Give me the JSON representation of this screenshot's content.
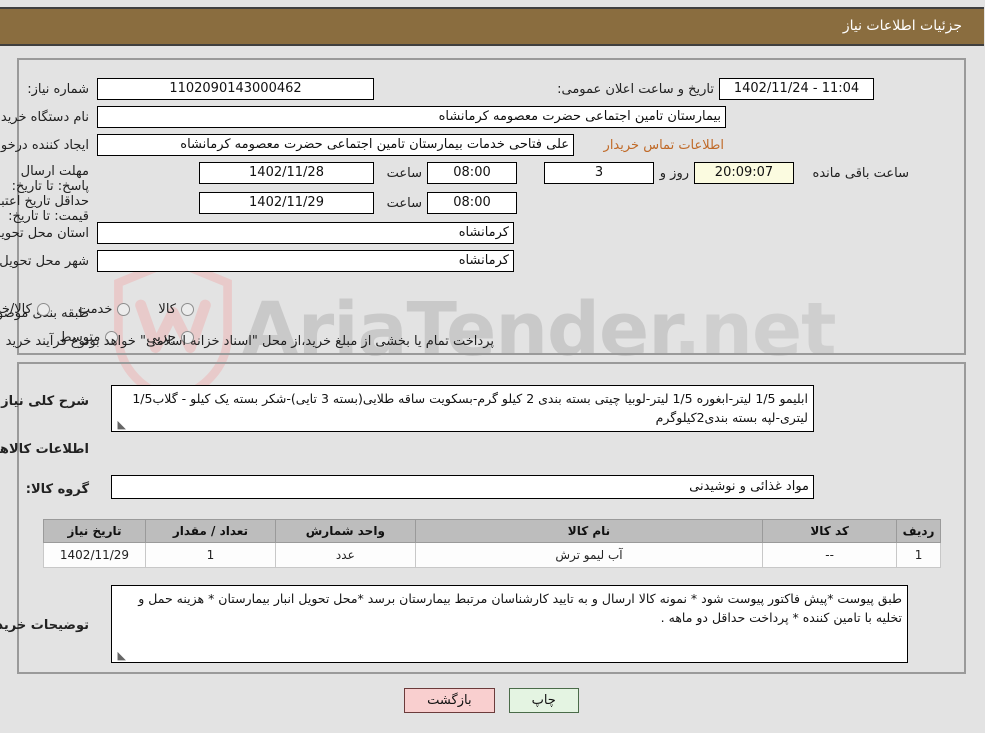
{
  "header": {
    "title": "جزئیات اطلاعات نیاز"
  },
  "watermark": {
    "text": "AriaTender",
    "suffix": ".net"
  },
  "form": {
    "need_number_label": "شماره نیاز:",
    "need_number_value": "1102090143000462",
    "announce_datetime_label": "تاریخ و ساعت اعلان عمومی:",
    "announce_datetime_value": "11:04 - 1402/11/24",
    "buyer_org_label": "نام دستگاه خریدار:",
    "buyer_org_value": "بیمارستان تامین اجتماعی حضرت معصومه کرمانشاه",
    "requester_label": "ایجاد کننده درخواست:",
    "requester_value": "علی  فتاحی خدمات بیمارستان تامین اجتماعی حضرت معصومه کرمانشاه",
    "contact_link": "اطلاعات تماس خریدار",
    "reply_deadline_label": "مهلت ارسال پاسخ: تا تاریخ:",
    "reply_deadline_date": "1402/11/28",
    "reply_deadline_time_label": "ساعت",
    "reply_deadline_time": "08:00",
    "remaining_days": "3",
    "remaining_days_label": "روز و",
    "remaining_clock": "20:09:07",
    "remaining_suffix": "ساعت باقی مانده",
    "price_validity_label": "حداقل تاریخ اعتبار قیمت: تا تاریخ:",
    "price_validity_date": "1402/11/29",
    "price_validity_time_label": "ساعت",
    "price_validity_time": "08:00",
    "province_label": "استان محل تحویل:",
    "province_value": "کرمانشاه",
    "city_label": "شهر محل تحویل:",
    "city_value": "کرمانشاه",
    "category_label": "طبقه بندی موضوعی:",
    "category_options": [
      "کالا",
      "خدمت",
      "کالا/خدمت"
    ],
    "process_label": "نوع فرآیند خرید :",
    "process_options": [
      "جزیی",
      "متوسط"
    ],
    "payment_note": "پرداخت تمام یا بخشی از مبلغ خرید،از محل \"اسناد خزانه اسلامی\" خواهد بود."
  },
  "summary": {
    "label": "شرح کلی نیاز:",
    "value": "ابلیمو 1/5 لیتر-ابغوره 1/5 لیتر-لوبیا چیتی بسته بندی 2 کیلو گرم-بسکویت ساقه طلایی(بسته 3 تایی)-شکر بسته یک کیلو  - گلاب1/5 لیتری-لپه بسته بندی2کیلوگرم"
  },
  "goods_section": {
    "title": "اطلاعات کالاهای مورد نیاز",
    "group_label": "گروه کالا:",
    "group_value": "مواد غذائی و نوشیدنی"
  },
  "table": {
    "columns": [
      "ردیف",
      "کد کالا",
      "نام کالا",
      "واحد شمارش",
      "تعداد / مقدار",
      "تاریخ نیاز"
    ],
    "rows": [
      [
        "1",
        "--",
        "آب لیمو ترش",
        "عدد",
        "1",
        "1402/11/29"
      ]
    ]
  },
  "buyer_notes": {
    "label": "توضیحات خریدار:",
    "value": "طبق پیوست *پیش فاکتور پیوست شود * نمونه کالا ارسال و به تایید کارشناسان مرتبط بیمارستان برسد *محل تحویل انبار بیمارستان * هزینه حمل و تخلیه با تامین کننده * پرداخت حداقل دو ماهه ."
  },
  "buttons": {
    "back": "بازگشت",
    "print": "چاپ"
  },
  "colors": {
    "header_bar": "#8a6d3f",
    "link": "#c06a28",
    "back_button": "#f9cfcf",
    "print_button": "#e4f4e2",
    "countdown_bg": "#fbfbe0"
  }
}
